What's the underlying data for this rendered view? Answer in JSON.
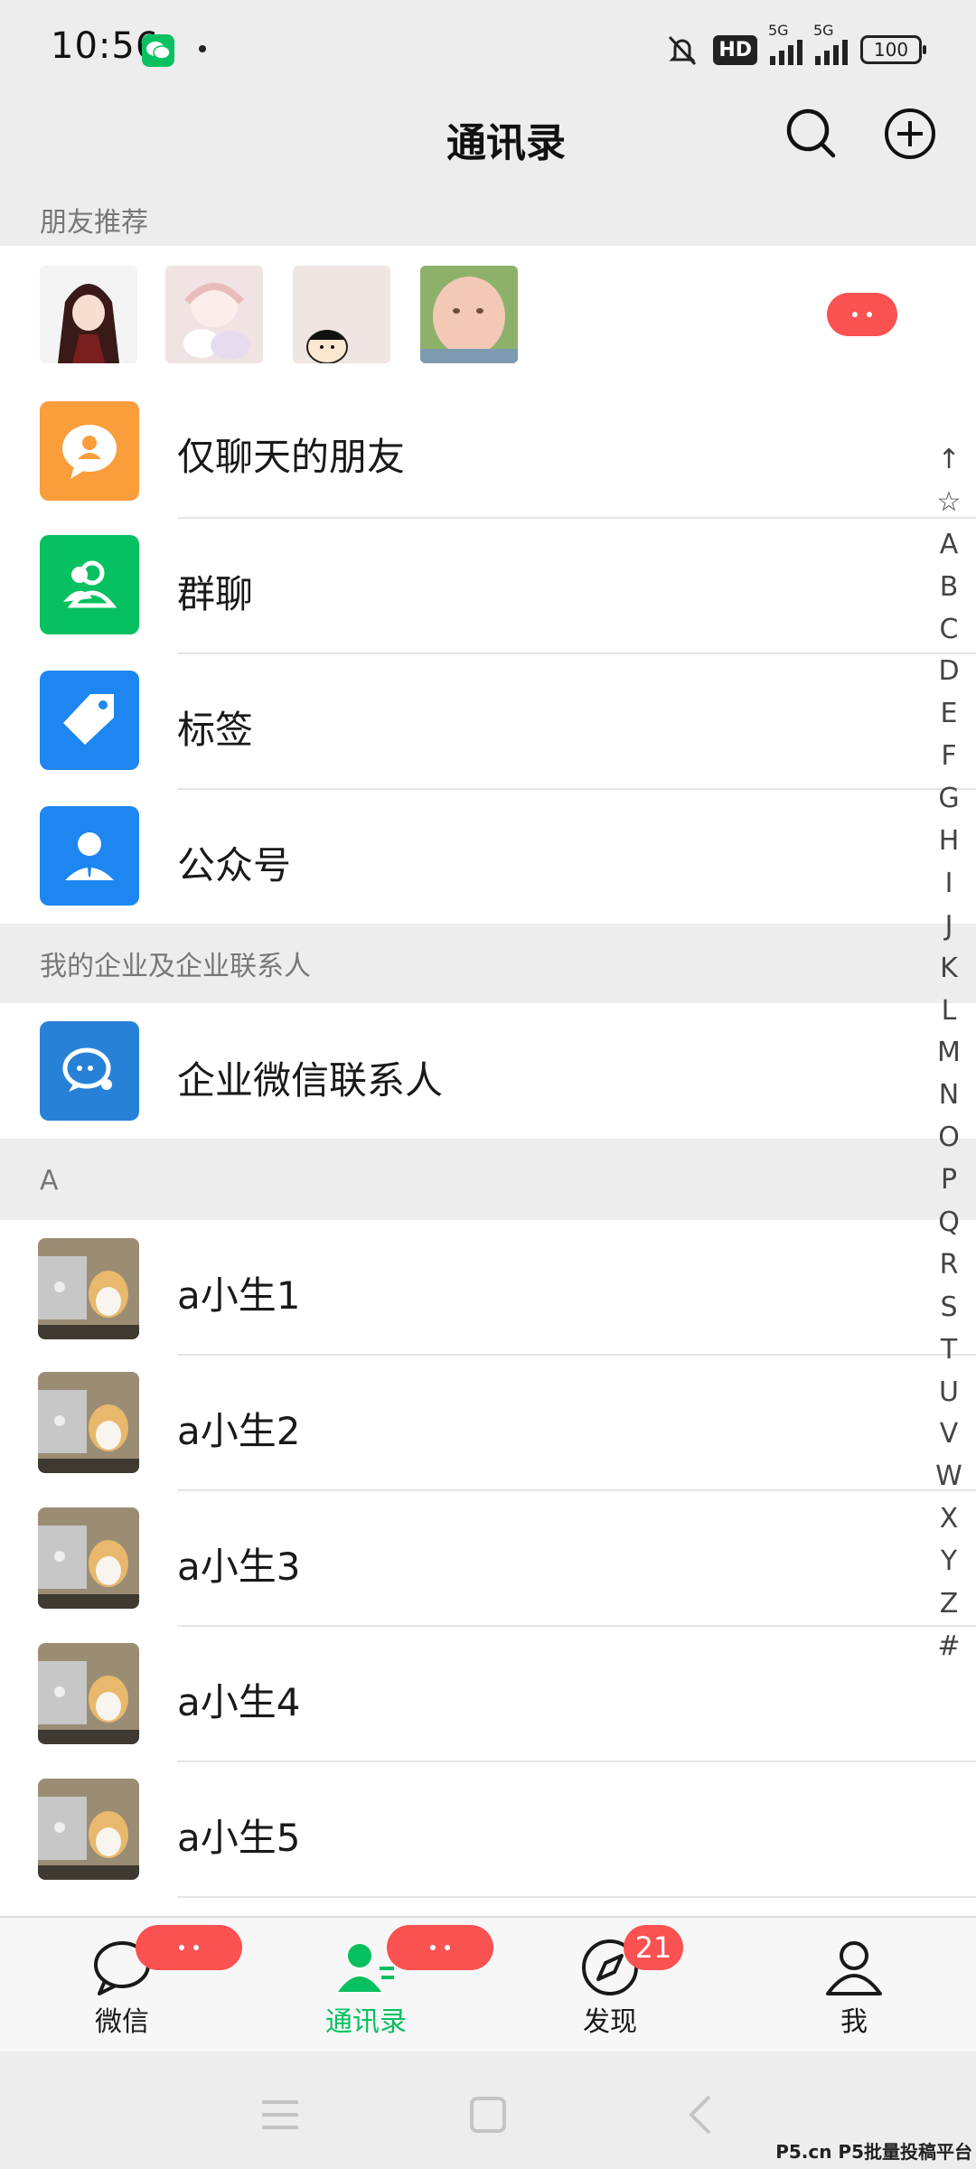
{
  "status_bar": {
    "time": "10:56",
    "hd_label": "HD",
    "network1": "5G",
    "network2": "5G",
    "battery": "100"
  },
  "header": {
    "title": "通讯录"
  },
  "sections": {
    "friend_recommend": "朋友推荐",
    "enterprise": "我的企业及企业联系人",
    "letter_a": "A"
  },
  "menu_items": [
    {
      "label": "仅聊天的朋友",
      "color": "#fa9d3b",
      "icon": "chat-friend-icon"
    },
    {
      "label": "群聊",
      "color": "#07c160",
      "icon": "group-chat-icon"
    },
    {
      "label": "标签",
      "color": "#2782d7",
      "icon": "tag-icon"
    },
    {
      "label": "公众号",
      "color": "#2782d7",
      "icon": "official-account-icon"
    }
  ],
  "enterprise_item": {
    "label": "企业微信联系人",
    "color": "#2782d7",
    "icon": "wecom-icon"
  },
  "contacts": [
    {
      "name": "a小生1"
    },
    {
      "name": "a小生2"
    },
    {
      "name": "a小生3"
    },
    {
      "name": "a小生4"
    },
    {
      "name": "a小生5"
    }
  ],
  "index_letters": [
    "↑",
    "☆",
    "A",
    "B",
    "C",
    "D",
    "E",
    "F",
    "G",
    "H",
    "I",
    "J",
    "K",
    "L",
    "M",
    "N",
    "O",
    "P",
    "Q",
    "R",
    "S",
    "T",
    "U",
    "V",
    "W",
    "X",
    "Y",
    "Z",
    "#"
  ],
  "tabs": [
    {
      "label": "微信",
      "icon": "chat-bubble-icon",
      "badge": "dots"
    },
    {
      "label": "通讯录",
      "icon": "contacts-icon",
      "badge": "dots",
      "active": true
    },
    {
      "label": "发现",
      "icon": "compass-icon",
      "badge": "21"
    },
    {
      "label": "我",
      "icon": "person-icon"
    }
  ],
  "watermark": "P5.cn P5批量投稿平台",
  "colors": {
    "accent": "#07c160",
    "badge": "#fa5151"
  }
}
